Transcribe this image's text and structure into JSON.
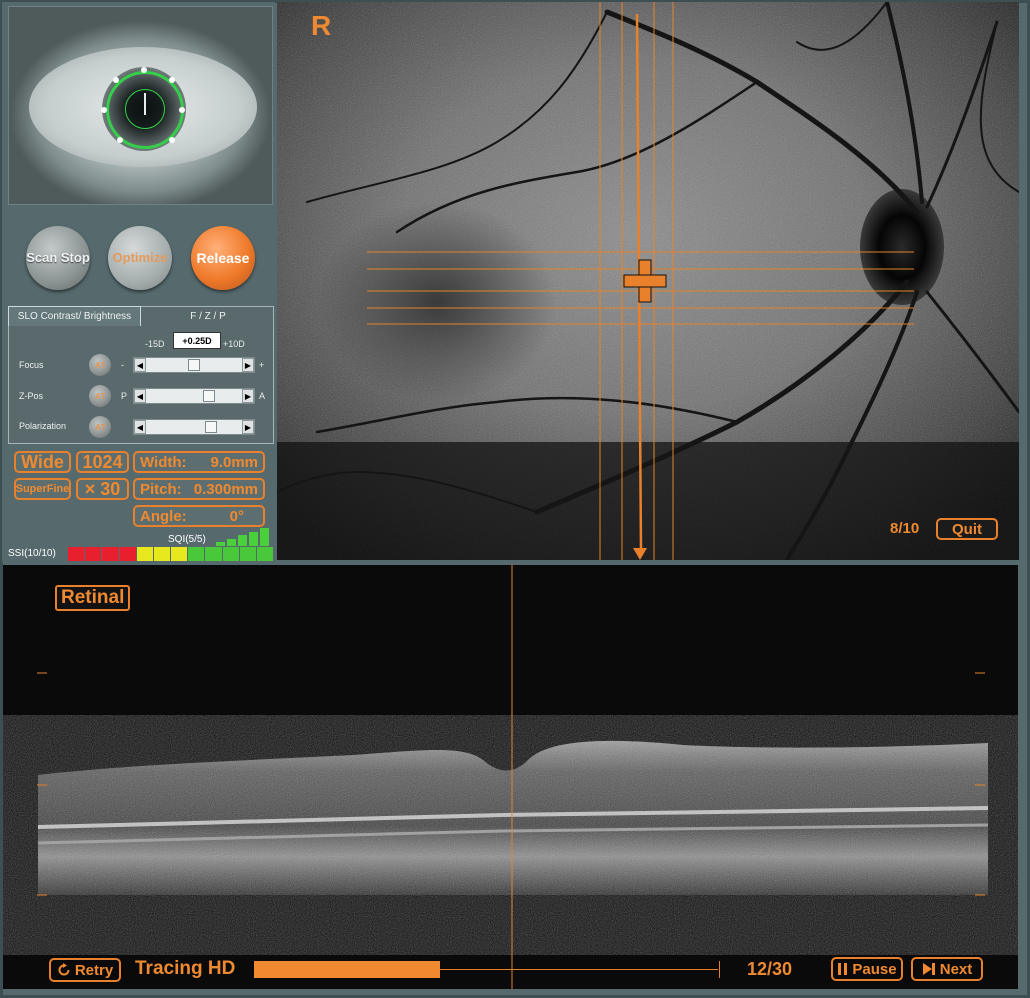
{
  "left_panel": {
    "buttons": {
      "scan_stop": "Scan Stop",
      "optimize": "Optimize",
      "release": "Release"
    },
    "tabs": {
      "slo": "SLO Contrast/ Brightness",
      "fzp": "F / Z / P"
    },
    "diopter": {
      "min": "-15D",
      "value": "+0.25D",
      "max": "+10D"
    },
    "sliders": [
      {
        "label": "Focus",
        "at": "AT",
        "left_marker": "-",
        "right_marker": "+",
        "level": 0.5
      },
      {
        "label": "Z-Pos",
        "at": "AT",
        "left_marker": "P",
        "right_marker": "A",
        "level": 0.68
      },
      {
        "label": "Polarization",
        "at": "AT",
        "left_marker": "",
        "right_marker": "",
        "level": 0.7
      }
    ],
    "scan_params": {
      "mode": "Wide",
      "resolution": "1024",
      "quality": "SuperFine",
      "averaging": "× 30",
      "width": {
        "label": "Width:",
        "value": "9.0mm"
      },
      "pitch": {
        "label": "Pitch:",
        "value": "0.300mm"
      },
      "angle": {
        "label": "Angle:",
        "value": "0°"
      }
    },
    "sqi": {
      "label": "SQI(5/5)",
      "level": 5,
      "max": 5
    },
    "ssi": {
      "label": "SSI(10/10)",
      "segments": [
        "#e8202e",
        "#e8202e",
        "#e8202e",
        "#e8202e",
        "#e8e81e",
        "#e8e81e",
        "#e8e81e",
        "#49c83a",
        "#49c83a",
        "#49c83a",
        "#49c83a",
        "#49c83a"
      ]
    }
  },
  "fundus": {
    "eye_side": "R",
    "page": "8/10",
    "quit": "Quit",
    "accent": "#e8802c"
  },
  "bscan": {
    "label": "Retinal",
    "retry": "Retry",
    "tracing": "Tracing HD",
    "progress": 0.4,
    "count": "12/30",
    "pause": "Pause",
    "next": "Next"
  },
  "icons": [
    "retry-icon",
    "pause-icon",
    "next-icon"
  ]
}
